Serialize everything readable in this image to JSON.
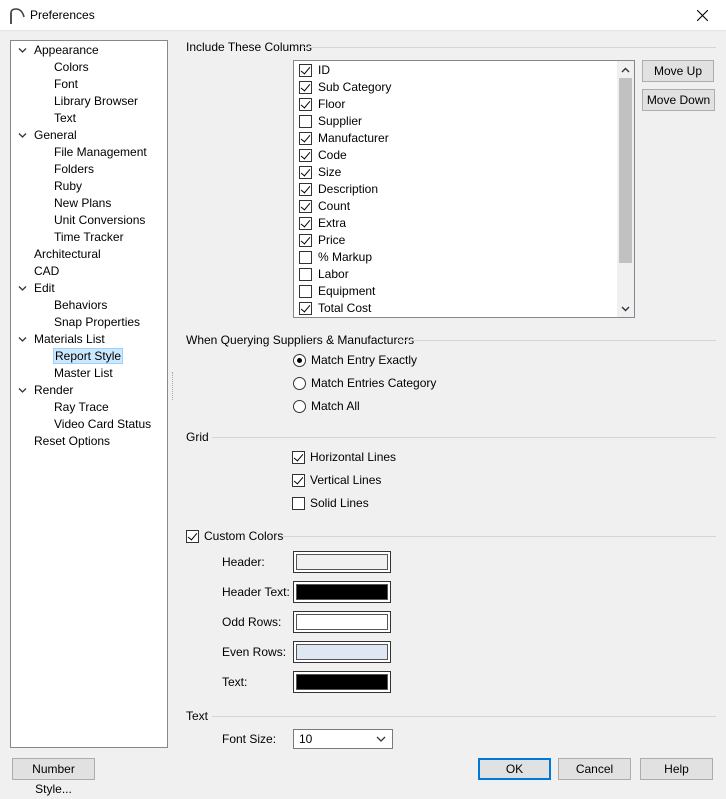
{
  "window": {
    "title": "Preferences"
  },
  "tree": {
    "items": [
      {
        "label": "Appearance",
        "level": 0,
        "expander": true
      },
      {
        "label": "Colors",
        "level": 1
      },
      {
        "label": "Font",
        "level": 1
      },
      {
        "label": "Library Browser",
        "level": 1
      },
      {
        "label": "Text",
        "level": 1
      },
      {
        "label": "General",
        "level": 0,
        "expander": true
      },
      {
        "label": "File Management",
        "level": 1
      },
      {
        "label": "Folders",
        "level": 1
      },
      {
        "label": "Ruby",
        "level": 1
      },
      {
        "label": "New Plans",
        "level": 1
      },
      {
        "label": "Unit Conversions",
        "level": 1
      },
      {
        "label": "Time Tracker",
        "level": 1
      },
      {
        "label": "Architectural",
        "level": 0
      },
      {
        "label": "CAD",
        "level": 0
      },
      {
        "label": "Edit",
        "level": 0,
        "expander": true
      },
      {
        "label": "Behaviors",
        "level": 1
      },
      {
        "label": "Snap Properties",
        "level": 1
      },
      {
        "label": "Materials List",
        "level": 0,
        "expander": true
      },
      {
        "label": "Report Style",
        "level": 1,
        "selected": true
      },
      {
        "label": "Master List",
        "level": 1
      },
      {
        "label": "Render",
        "level": 0,
        "expander": true
      },
      {
        "label": "Ray Trace",
        "level": 1
      },
      {
        "label": "Video Card Status",
        "level": 1
      },
      {
        "label": "Reset Options",
        "level": 0
      }
    ]
  },
  "columns": {
    "title": "Include These Columns",
    "items": [
      {
        "label": "ID",
        "checked": true
      },
      {
        "label": "Sub Category",
        "checked": true
      },
      {
        "label": "Floor",
        "checked": true
      },
      {
        "label": "Supplier",
        "checked": false
      },
      {
        "label": "Manufacturer",
        "checked": true
      },
      {
        "label": "Code",
        "checked": true
      },
      {
        "label": "Size",
        "checked": true
      },
      {
        "label": "Description",
        "checked": true
      },
      {
        "label": "Count",
        "checked": true
      },
      {
        "label": "Extra",
        "checked": true
      },
      {
        "label": "Price",
        "checked": true
      },
      {
        "label": "% Markup",
        "checked": false
      },
      {
        "label": "Labor",
        "checked": false
      },
      {
        "label": "Equipment",
        "checked": false
      },
      {
        "label": "Total Cost",
        "checked": true
      }
    ],
    "move_up": "Move Up",
    "move_down": "Move Down"
  },
  "querying": {
    "title": "When Querying Suppliers & Manufacturers",
    "options": [
      {
        "label": "Match Entry Exactly",
        "selected": true
      },
      {
        "label": "Match Entries Category",
        "selected": false
      },
      {
        "label": "Match All",
        "selected": false
      }
    ]
  },
  "grid": {
    "title": "Grid",
    "options": [
      {
        "label": "Horizontal Lines",
        "checked": true
      },
      {
        "label": "Vertical Lines",
        "checked": true
      },
      {
        "label": "Solid Lines",
        "checked": false
      }
    ]
  },
  "custom_colors": {
    "label": "Custom Colors",
    "checked": true,
    "items": [
      {
        "label": "Header:",
        "color": "#f0f0f0"
      },
      {
        "label": "Header Text:",
        "color": "#000000"
      },
      {
        "label": "Odd Rows:",
        "color": "#ffffff"
      },
      {
        "label": "Even Rows:",
        "color": "#dfe8f2"
      },
      {
        "label": "Text:",
        "color": "#000000"
      }
    ]
  },
  "text": {
    "title": "Text",
    "font_size_label": "Font Size:",
    "font_size_value": "10"
  },
  "footer": {
    "number_style": "Number Style...",
    "ok": "OK",
    "cancel": "Cancel",
    "help": "Help"
  }
}
